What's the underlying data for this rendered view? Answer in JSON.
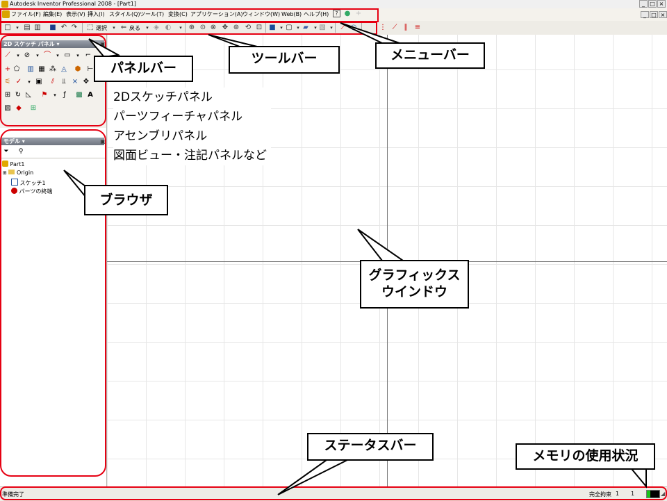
{
  "window": {
    "title": "Autodesk Inventor Professional 2008 - [Part1]",
    "controls": [
      "_",
      "□",
      "×"
    ],
    "doc_controls": [
      "_",
      "□",
      "×"
    ]
  },
  "menubar": {
    "items": [
      "ファイル(F)",
      "編集(E)",
      "表示(V)",
      "挿入(I)",
      "スタイル(Q)",
      "ツール(T)",
      "変換(C)",
      "アプリケーション(A)",
      "ウィンドウ(W)",
      "Web(B)",
      "ヘルプ(H)"
    ]
  },
  "toolbar": {
    "select_label": "選択",
    "back_label": "戻る"
  },
  "panelbar": {
    "title": "2D スケッチ パネル ▾"
  },
  "browser": {
    "title": "モデル ▾",
    "tree": [
      "Part1",
      "Origin",
      "スケッチ1",
      "パーツの終端"
    ]
  },
  "panel_types": [
    "2Dスケッチパネル",
    "パーツフィーチャパネル",
    "アセンブリパネル",
    "図面ビュー・注記パネルなど"
  ],
  "callouts": {
    "panelbar": "パネルバー",
    "toolbar": "ツールバー",
    "menubar": "メニューバー",
    "browser": "ブラウザ",
    "graphics": "グラフィックスウインドウ",
    "graphics_line1": "グラフィックス",
    "graphics_line2": "ウインドウ",
    "statusbar": "ステータスバー",
    "memory": "メモリの使用状況"
  },
  "statusbar": {
    "status": "準備完了",
    "constraint": "完全拘束",
    "value1": "1",
    "value2": "1"
  },
  "memory_usage_fraction": 0.3,
  "colors": {
    "highlight": "#e60012",
    "menubar_bg": "#f4f2ec",
    "grid": "#e6e6e6"
  }
}
